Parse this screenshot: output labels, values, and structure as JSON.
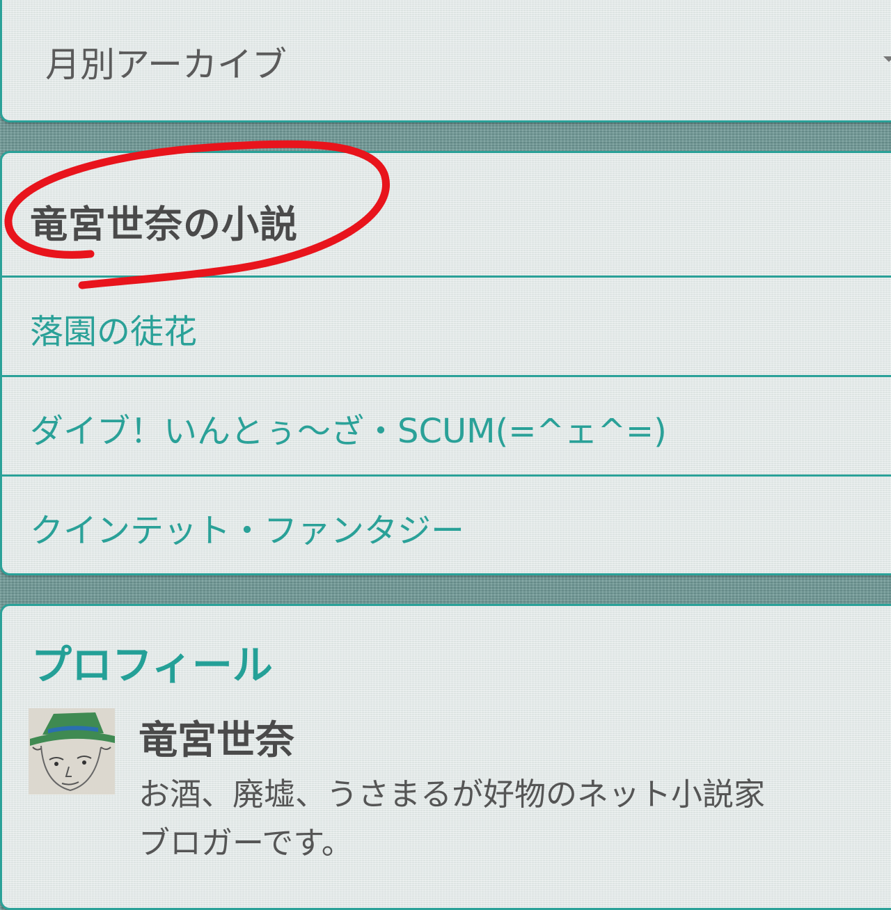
{
  "archive": {
    "select_value": "月別アーカイブ"
  },
  "novels": {
    "title": "竜宮世奈の小説",
    "items": [
      {
        "label": "落園の徒花"
      },
      {
        "label": "ダイブ！いんとぅ〜ざ・SCUM(=^ェ^=)"
      },
      {
        "label": "クインテット・ファンタジー"
      }
    ]
  },
  "profile": {
    "title": "プロフィール",
    "name": "竜宮世奈",
    "description_line1": "お酒、廃墟、うさまるが好物のネット小説家",
    "description_line2": "ブロガーです。"
  },
  "colors": {
    "accent": "#2aa198",
    "annotation": "#e8141c"
  },
  "icons": {
    "archive_dropdown": "chevron-down-icon"
  }
}
